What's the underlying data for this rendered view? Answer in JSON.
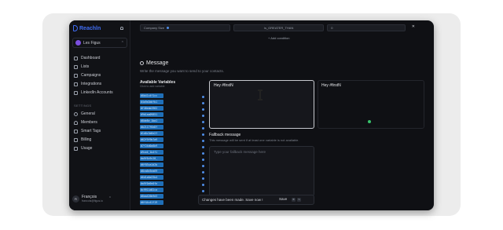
{
  "app": {
    "logo_text": "Reachln"
  },
  "workspace": {
    "name": "Les Figus"
  },
  "sidebar": {
    "nav": [
      {
        "label": "Dashboard",
        "icon": "dashboard-icon"
      },
      {
        "label": "Lists",
        "icon": "lists-icon"
      },
      {
        "label": "Campaigns",
        "icon": "campaigns-icon"
      },
      {
        "label": "Integrations",
        "icon": "integrations-icon"
      },
      {
        "label": "LinkedIn Accounts",
        "icon": "linkedin-icon"
      }
    ],
    "settings_label": "SETTINGS",
    "settings": [
      {
        "label": "General",
        "icon": "gear-icon"
      },
      {
        "label": "Members",
        "icon": "members-icon"
      },
      {
        "label": "Smart Tags",
        "icon": "tag-icon"
      },
      {
        "label": "Billing",
        "icon": "billing-icon"
      },
      {
        "label": "Usage",
        "icon": "usage-icon"
      }
    ],
    "user": {
      "initials": "FI",
      "name": "François",
      "email": "francois@figus.io"
    }
  },
  "filters": {
    "field": "Company Size",
    "operator": "is_GREATER_THAN",
    "value": "0",
    "add_condition": "+ Add condition"
  },
  "message": {
    "title": "Message",
    "subtitle": "Write the message you want to send to your contacts.",
    "available_title": "Available Variables",
    "available_sub": "Click to add variable",
    "variables": [
      "#8b41c4f1cc",
      "#4a9a3ddfb1",
      "#f46eab1962",
      "#9b1aa09851",
      "#8de8e_1ba1",
      "#b2117f6e8f",
      "#1d0c3d6e2f",
      "#62f9f9b7a9",
      "#7f24d0a8b9",
      "#9ce4_1b4f1",
      "#a9f6c9c28_",
      "#6f03ca1d2b",
      "#8ca6e3ea69",
      "#6d1a6a33b4",
      "#a9f0a9e0fe",
      "#c9911d82ca",
      "#8aa420b9d3",
      "#6f44c41f19"
    ],
    "editor_value": "Hey #firstN",
    "preview_value": "Hey #firstN"
  },
  "fallback": {
    "title": "Fallback message",
    "subtitle": "This message will be sent if at least one variable is not available.",
    "placeholder": "Type your fallback message here"
  },
  "save_bar": {
    "text": "Changes have been made. Save now !",
    "save_label": "Save",
    "key1": "⌘",
    "key2": "S"
  }
}
